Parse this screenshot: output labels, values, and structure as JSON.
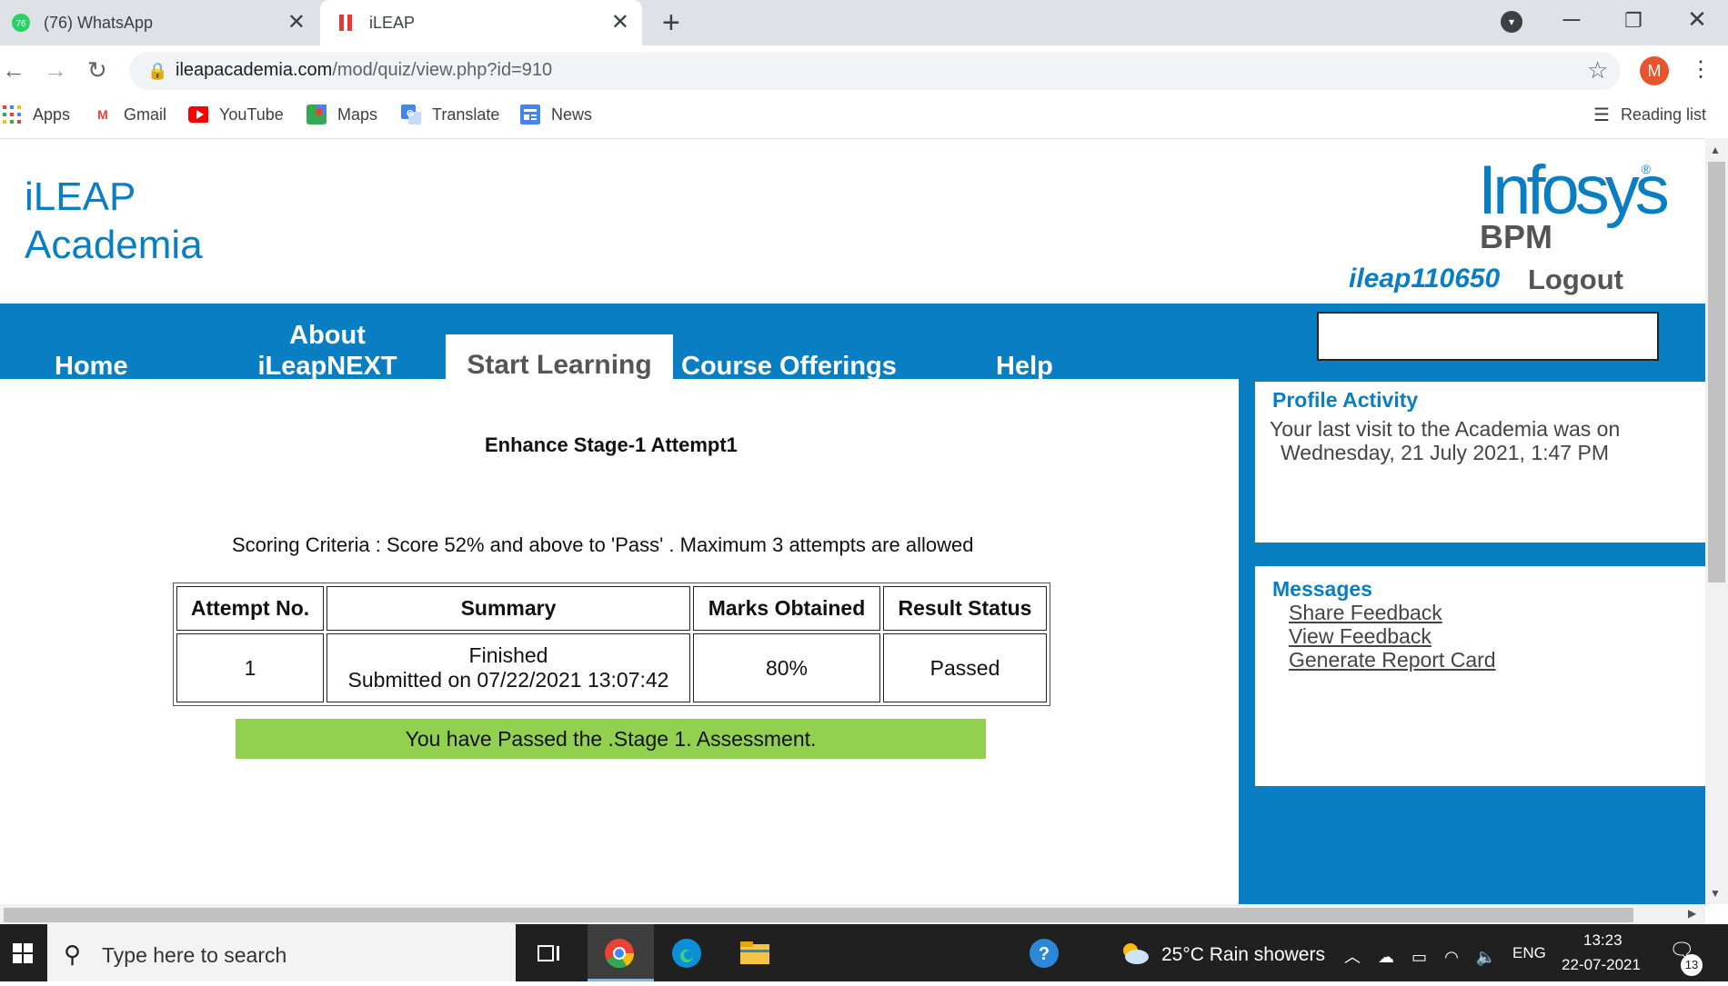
{
  "browser": {
    "tabs": [
      {
        "title": "(76) WhatsApp",
        "badge": "76",
        "active": false
      },
      {
        "title": "iLEAP",
        "active": true
      }
    ],
    "new_tab_symbol": "+",
    "url_domain": "ileapacademia.com",
    "url_path": "/mod/quiz/view.php?id=910",
    "profile_initial": "M",
    "bookmarks": [
      "Apps",
      "Gmail",
      "YouTube",
      "Maps",
      "Translate",
      "News"
    ],
    "reading_list": "Reading list"
  },
  "site": {
    "title_line1": "iLEAP",
    "title_line2": "Academia",
    "logo_brand": "Infosys",
    "logo_sub": "BPM",
    "logo_reg": "®",
    "username": "ileap110650",
    "logout": "Logout"
  },
  "nav": {
    "home": "Home",
    "about_line1": "About",
    "about_line2": "iLeapNEXT",
    "start_learning": "Start Learning",
    "course_offerings": "Course Offerings",
    "help": "Help",
    "search_value": ""
  },
  "quiz": {
    "title": "Enhance Stage-1 Attempt1",
    "criteria": "Scoring Criteria : Score 52% and above to 'Pass' . Maximum 3 attempts are allowed",
    "columns": [
      "Attempt No.",
      "Summary",
      "Marks Obtained",
      "Result Status"
    ],
    "rows": [
      {
        "attempt": "1",
        "summary_line1": "Finished",
        "summary_line2": "Submitted on 07/22/2021 13:07:42",
        "marks": "80%",
        "result": "Passed"
      }
    ],
    "banner": "You have Passed the .Stage 1. Assessment."
  },
  "sidebar": {
    "profile_heading": "Profile Activity",
    "profile_line1": "Your last visit to the Academia was on",
    "profile_line2": "Wednesday, 21 July 2021, 1:47 PM",
    "messages_heading": "Messages",
    "links": [
      "Share Feedback",
      "View Feedback",
      "Generate Report Card"
    ]
  },
  "taskbar": {
    "search_placeholder": "Type here to search",
    "weather": "25°C  Rain showers",
    "language": "ENG",
    "time": "13:23",
    "date": "22-07-2021",
    "notifications": "13"
  },
  "colors": {
    "brand_blue": "#0a7ec3",
    "pass_green": "#92d050",
    "taskbar": "#202020"
  }
}
